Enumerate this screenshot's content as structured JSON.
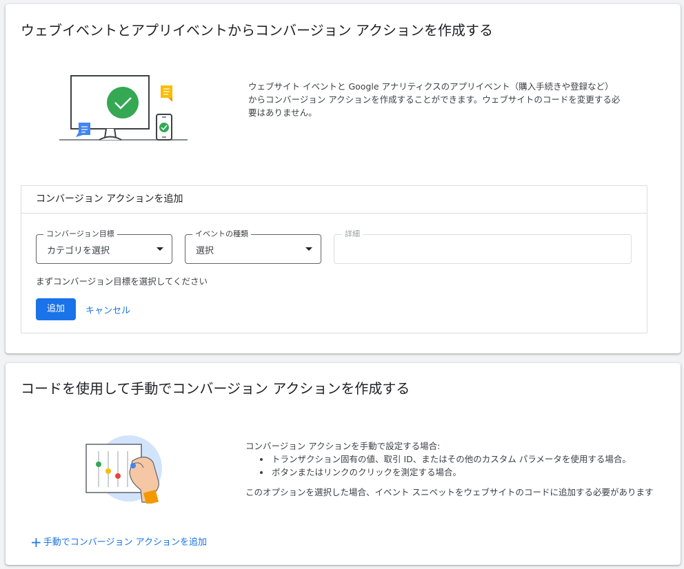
{
  "colors": {
    "accent": "#1a73e8",
    "success": "#34a853",
    "warning": "#fbbc04",
    "danger": "#ea4335",
    "background": "#f1f3f4"
  },
  "web_app_section": {
    "title": "ウェブイベントとアプリイベントからコンバージョン アクションを作成する",
    "illustration_icon": "monitor-phone-check-illustration",
    "description": "ウェブサイト イベントと Google アナリティクスのアプリイベント（購入手続きや登録など）からコンバージョン アクションを作成することができます。ウェブサイトのコードを変更する必要はありません。",
    "add_panel": {
      "header": "コンバージョン アクションを追加",
      "goal_field": {
        "label": "コンバージョン目標",
        "value": "カテゴリを選択"
      },
      "event_field": {
        "label": "イベントの種類",
        "value": "選択"
      },
      "detail_field": {
        "label": "詳細",
        "value": ""
      },
      "hint": "まずコンバージョン目標を選択してください",
      "add_label": "追加",
      "cancel_label": "キャンセル"
    }
  },
  "manual_section": {
    "title": "コードを使用して手動でコンバージョン アクションを作成する",
    "illustration_icon": "sliders-hand-illustration",
    "intro": "コンバージョン アクションを手動で設定する場合:",
    "bullets": [
      "トランザクション固有の値、取引 ID、またはその他のカスタム パラメータを使用する場合。",
      "ボタンまたはリンクのクリックを測定する場合。"
    ],
    "note": "このオプションを選択した場合、イベント スニペットをウェブサイトのコードに追加する必要があります",
    "add_link_label": "手動でコンバージョン アクションを追加",
    "add_link_icon": "plus-icon"
  }
}
